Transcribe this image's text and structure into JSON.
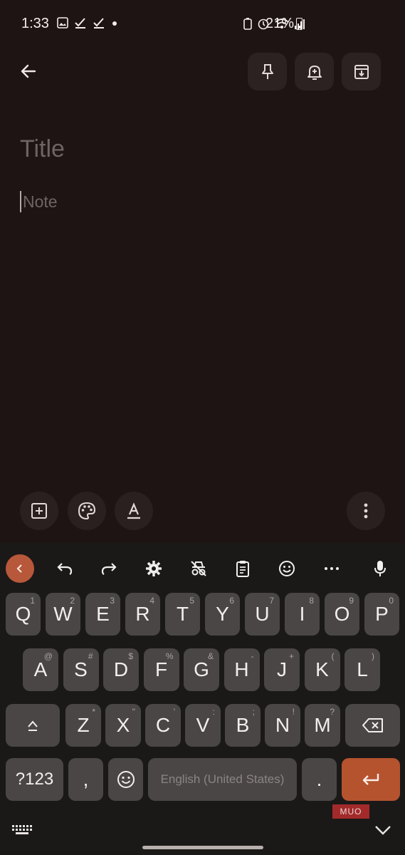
{
  "status_bar": {
    "time": "1:33",
    "battery": "21%"
  },
  "editor": {
    "title_placeholder": "Title",
    "note_placeholder": "Note"
  },
  "keyboard": {
    "row1": [
      {
        "k": "Q",
        "h": "1"
      },
      {
        "k": "W",
        "h": "2"
      },
      {
        "k": "E",
        "h": "3"
      },
      {
        "k": "R",
        "h": "4"
      },
      {
        "k": "T",
        "h": "5"
      },
      {
        "k": "Y",
        "h": "6"
      },
      {
        "k": "U",
        "h": "7"
      },
      {
        "k": "I",
        "h": "8"
      },
      {
        "k": "O",
        "h": "9"
      },
      {
        "k": "P",
        "h": "0"
      }
    ],
    "row2": [
      {
        "k": "A",
        "h": "@"
      },
      {
        "k": "S",
        "h": "#"
      },
      {
        "k": "D",
        "h": "$"
      },
      {
        "k": "F",
        "h": "%"
      },
      {
        "k": "G",
        "h": "&"
      },
      {
        "k": "H",
        "h": "-"
      },
      {
        "k": "J",
        "h": "+"
      },
      {
        "k": "K",
        "h": "("
      },
      {
        "k": "L",
        "h": ")"
      }
    ],
    "row3": [
      {
        "k": "Z",
        "h": "*"
      },
      {
        "k": "X",
        "h": "\""
      },
      {
        "k": "C",
        "h": "'"
      },
      {
        "k": "V",
        "h": ":"
      },
      {
        "k": "B",
        "h": ";"
      },
      {
        "k": "N",
        "h": "!"
      },
      {
        "k": "M",
        "h": "?"
      }
    ],
    "symbols_label": "?123",
    "comma_label": ",",
    "period_label": ".",
    "space_label": "English (United States)"
  },
  "watermark": "MUO",
  "accent_color": "#b8583b"
}
